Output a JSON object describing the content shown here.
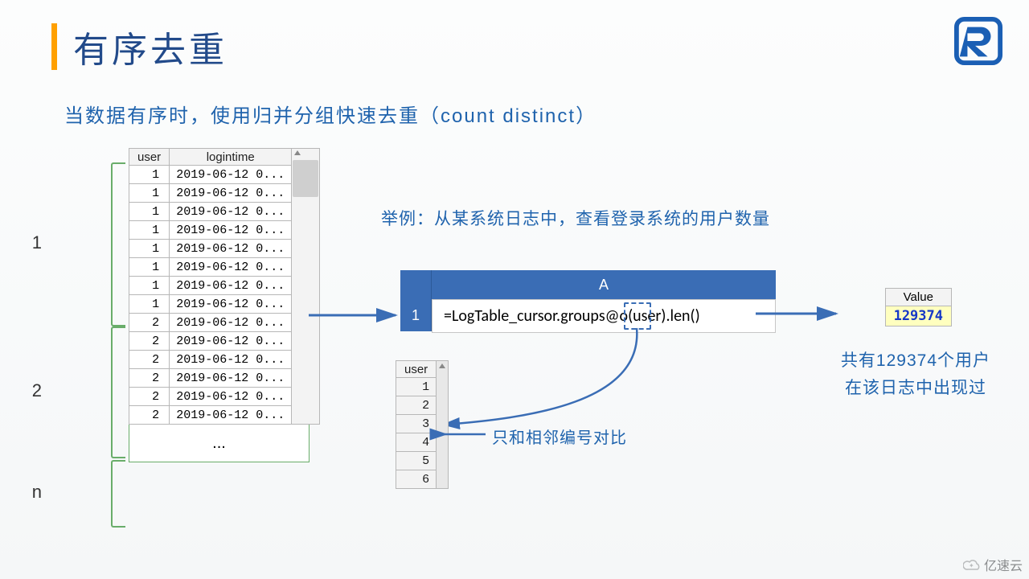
{
  "title": "有序去重",
  "subtitle": "当数据有序时，使用归并分组快速去重（count distinct）",
  "example_caption": "举例：从某系统日志中，查看登录系统的用户数量",
  "log_table": {
    "headers": [
      "user",
      "logintime"
    ],
    "rows": [
      {
        "user": "1",
        "logintime": "2019-06-12 0..."
      },
      {
        "user": "1",
        "logintime": "2019-06-12 0..."
      },
      {
        "user": "1",
        "logintime": "2019-06-12 0..."
      },
      {
        "user": "1",
        "logintime": "2019-06-12 0..."
      },
      {
        "user": "1",
        "logintime": "2019-06-12 0..."
      },
      {
        "user": "1",
        "logintime": "2019-06-12 0..."
      },
      {
        "user": "1",
        "logintime": "2019-06-12 0..."
      },
      {
        "user": "1",
        "logintime": "2019-06-12 0..."
      },
      {
        "user": "2",
        "logintime": "2019-06-12 0..."
      },
      {
        "user": "2",
        "logintime": "2019-06-12 0..."
      },
      {
        "user": "2",
        "logintime": "2019-06-12 0..."
      },
      {
        "user": "2",
        "logintime": "2019-06-12 0..."
      },
      {
        "user": "2",
        "logintime": "2019-06-12 0..."
      },
      {
        "user": "2",
        "logintime": "2019-06-12 0..."
      }
    ],
    "ellipsis": "...",
    "group_labels": [
      "1",
      "2",
      "n"
    ]
  },
  "formula": {
    "col_header": "A",
    "row_header": "1",
    "expression": "=LogTable_cursor.groups@o(user).len()"
  },
  "user_list": {
    "header": "user",
    "rows": [
      "1",
      "2",
      "3",
      "4",
      "5",
      "6"
    ]
  },
  "annotation_adjacent": "只和相邻编号对比",
  "value_box": {
    "header": "Value",
    "value": "129374"
  },
  "result_caption_line1": "共有129374个用户",
  "result_caption_line2": "在该日志中出现过",
  "watermark": "亿速云"
}
